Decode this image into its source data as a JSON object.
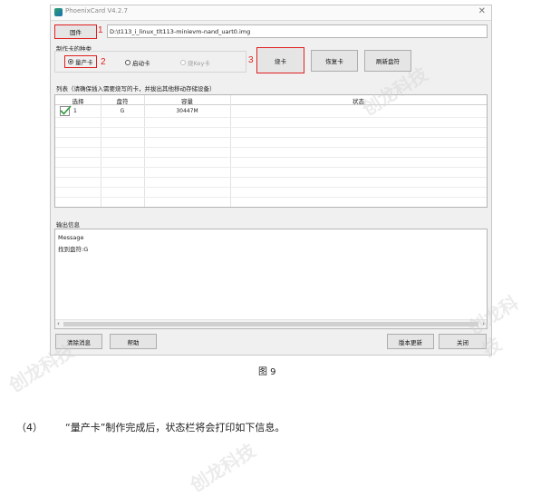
{
  "window": {
    "title": "PhoenixCard V4.2.7",
    "close_glyph": "✕",
    "firmware_button": "固件",
    "firmware_path": "D:\\t113_i_linux_tlt113-minievm-nand_uart0.img",
    "card_type_label": "制作卡的种类",
    "card_types": [
      {
        "label": "量产卡",
        "selected": true,
        "enabled": true
      },
      {
        "label": "启动卡",
        "selected": false,
        "enabled": true
      },
      {
        "label": "烧Key卡",
        "selected": false,
        "enabled": false
      }
    ],
    "actions": {
      "burn": "烧卡",
      "restore": "恢复卡",
      "refresh": "刷新盘符"
    },
    "list_label": "列表（请确保插入需要烧写的卡，并拔出其他移动存储设备）",
    "table": {
      "columns": [
        "选择",
        "盘符",
        "容量",
        "状态"
      ],
      "rows": [
        {
          "index": "1",
          "drive": "G",
          "capacity": "30447M",
          "status": "",
          "checked": true
        }
      ]
    },
    "output_label": "输出信息",
    "output_lines": [
      "Message",
      "找到盘符:G"
    ],
    "bottom_buttons": {
      "clear": "清除消息",
      "help": "帮助",
      "update": "版本更新",
      "close": "关闭"
    }
  },
  "annotations": [
    "1",
    "2",
    "3"
  ],
  "caption": "图 9",
  "paragraph": {
    "number": "（4）",
    "text": "“量产卡”制作完成后，状态栏将会打印如下信息。"
  },
  "watermark": "创龙科技",
  "colors": {
    "annotation_red": "#e02020",
    "check_green": "#2a9a3a"
  }
}
